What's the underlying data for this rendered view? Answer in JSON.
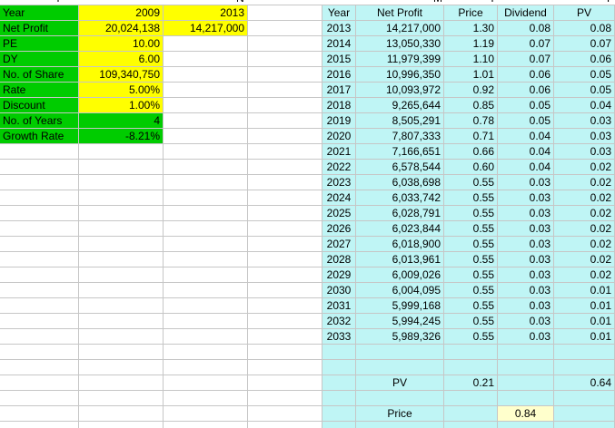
{
  "clipped_header": {
    "col_a": "Y",
    "col_h": "N",
    "col_k": "M",
    "col_l": "Y",
    "col_n": "F"
  },
  "inputs": {
    "header": [
      "Year",
      "2009",
      "2013"
    ],
    "rows": [
      {
        "label": "Net Profit",
        "v2009": "20,024,138",
        "v2013": "14,217,000"
      },
      {
        "label": "PE",
        "v2009": "10.00",
        "v2013": ""
      },
      {
        "label": "DY",
        "v2009": "6.00",
        "v2013": ""
      },
      {
        "label": "No. of Share",
        "v2009": "109,340,750",
        "v2013": ""
      },
      {
        "label": "Rate",
        "v2009": "5.00%",
        "v2013": ""
      },
      {
        "label": "Discount",
        "v2009": "1.00%",
        "v2013": ""
      },
      {
        "label": "No. of Years",
        "v2009": "4",
        "v2013": ""
      },
      {
        "label": "Growth Rate",
        "v2009": "-8.21%",
        "v2013": ""
      }
    ]
  },
  "projection": {
    "headers": [
      "Year",
      "Net Profit",
      "Price",
      "Dividend",
      "PV"
    ],
    "rows": [
      [
        "2013",
        "14,217,000",
        "1.30",
        "0.08",
        "0.08"
      ],
      [
        "2014",
        "13,050,330",
        "1.19",
        "0.07",
        "0.07"
      ],
      [
        "2015",
        "11,979,399",
        "1.10",
        "0.07",
        "0.06"
      ],
      [
        "2016",
        "10,996,350",
        "1.01",
        "0.06",
        "0.05"
      ],
      [
        "2017",
        "10,093,972",
        "0.92",
        "0.06",
        "0.05"
      ],
      [
        "2018",
        "9,265,644",
        "0.85",
        "0.05",
        "0.04"
      ],
      [
        "2019",
        "8,505,291",
        "0.78",
        "0.05",
        "0.03"
      ],
      [
        "2020",
        "7,807,333",
        "0.71",
        "0.04",
        "0.03"
      ],
      [
        "2021",
        "7,166,651",
        "0.66",
        "0.04",
        "0.03"
      ],
      [
        "2022",
        "6,578,544",
        "0.60",
        "0.04",
        "0.02"
      ],
      [
        "2023",
        "6,038,698",
        "0.55",
        "0.03",
        "0.02"
      ],
      [
        "2024",
        "6,033,742",
        "0.55",
        "0.03",
        "0.02"
      ],
      [
        "2025",
        "6,028,791",
        "0.55",
        "0.03",
        "0.02"
      ],
      [
        "2026",
        "6,023,844",
        "0.55",
        "0.03",
        "0.02"
      ],
      [
        "2027",
        "6,018,900",
        "0.55",
        "0.03",
        "0.02"
      ],
      [
        "2028",
        "6,013,961",
        "0.55",
        "0.03",
        "0.02"
      ],
      [
        "2029",
        "6,009,026",
        "0.55",
        "0.03",
        "0.02"
      ],
      [
        "2030",
        "6,004,095",
        "0.55",
        "0.03",
        "0.01"
      ],
      [
        "2031",
        "5,999,168",
        "0.55",
        "0.03",
        "0.01"
      ],
      [
        "2032",
        "5,994,245",
        "0.55",
        "0.03",
        "0.01"
      ],
      [
        "2033",
        "5,989,326",
        "0.55",
        "0.03",
        "0.01"
      ]
    ],
    "pv_label": "PV",
    "pv_price": "0.21",
    "pv_total": "0.64",
    "price_label": "Price",
    "price_value": "0.84"
  },
  "colors": {
    "green": "#00cc00",
    "yellow": "#ffff00",
    "cyan": "#bff5f5",
    "pale_yellow": "#ffffcc",
    "gridline": "#c6c6c6"
  }
}
